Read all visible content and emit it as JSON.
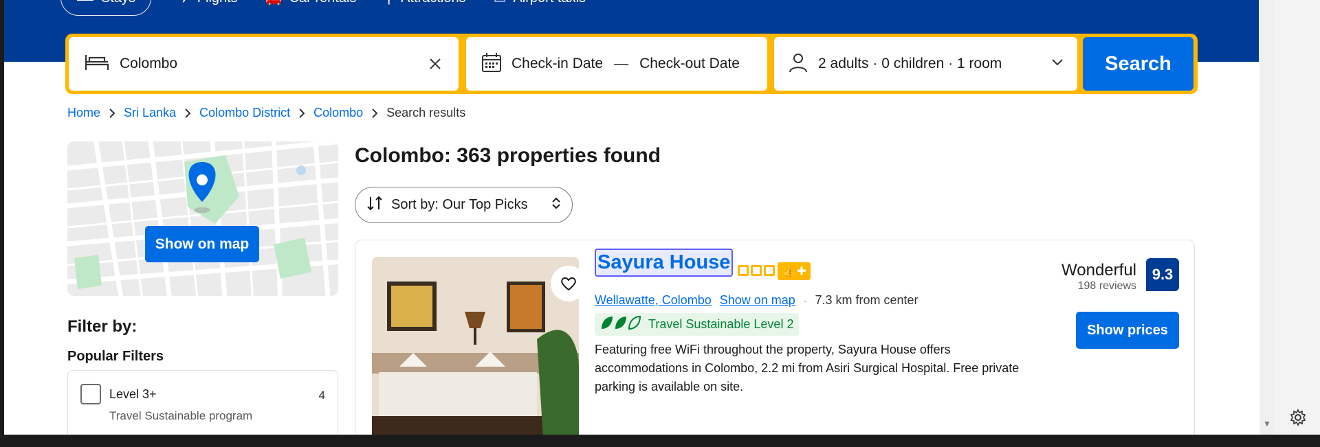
{
  "nav": {
    "items": [
      {
        "label": "Stays",
        "icon": "bed-icon"
      },
      {
        "label": "Flights",
        "icon": "plane-icon"
      },
      {
        "label": "Car rentals",
        "icon": "car-icon"
      },
      {
        "label": "Attractions",
        "icon": "ferris-wheel-icon"
      },
      {
        "label": "Airport taxis",
        "icon": "taxi-icon"
      }
    ]
  },
  "search": {
    "destination": "Colombo",
    "checkin": "Check-in Date",
    "separator": "—",
    "checkout": "Check-out Date",
    "occupancy": "2 adults · 0 children · 1 room",
    "button": "Search"
  },
  "breadcrumb": {
    "items": [
      "Home",
      "Sri Lanka",
      "Colombo District",
      "Colombo"
    ],
    "current": "Search results"
  },
  "map": {
    "button": "Show on map"
  },
  "filters": {
    "title": "Filter by:",
    "popular_title": "Popular Filters",
    "items": [
      {
        "label": "Level 3+",
        "sublabel": "Travel Sustainable program",
        "count": "4"
      }
    ]
  },
  "results": {
    "title": "Colombo: 363 properties found",
    "sort_label": "Sort by: Our Top Picks"
  },
  "property": {
    "name": "Sayura House",
    "location": "Wellawatte, Colombo",
    "show_on_map": "Show on map",
    "dot": "·",
    "distance": "7.3 km from center",
    "sustainable": "Travel Sustainable Level 2",
    "description": "Featuring free WiFi throughout the property, Sayura House offers accommodations in Colombo, 2.2 mi from Asiri Surgical Hospital. Free private parking is available on site.",
    "rating_word": "Wonderful",
    "reviews": "198 reviews",
    "score": "9.3",
    "price_button": "Show prices",
    "star_rating": 3
  },
  "colors": {
    "brand_blue": "#003b95",
    "action_blue": "#006ce4",
    "accent_yellow": "#ffb700",
    "sustain_green": "#008234"
  }
}
